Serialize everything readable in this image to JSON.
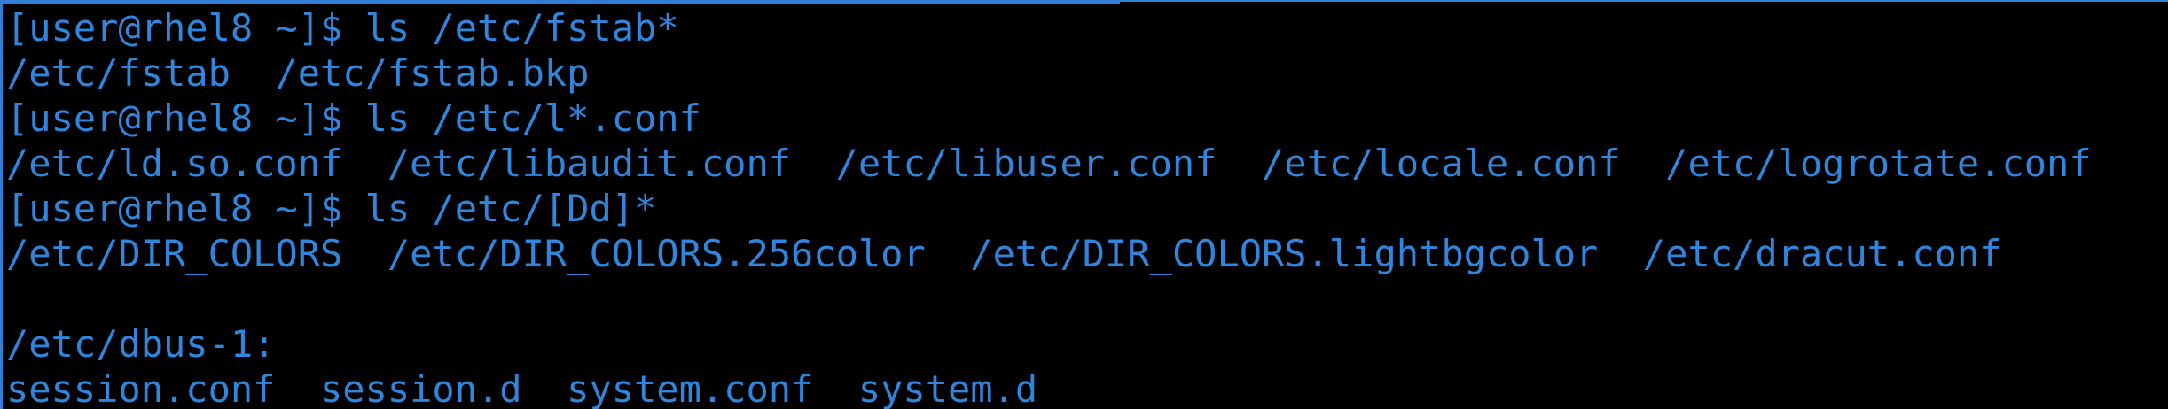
{
  "colors": {
    "background": "#000000",
    "text": "#2f86dc",
    "border": "#2f7fd6"
  },
  "terminal": {
    "lines": [
      "[user@rhel8 ~]$ ls /etc/fstab*",
      "/etc/fstab  /etc/fstab.bkp",
      "[user@rhel8 ~]$ ls /etc/l*.conf",
      "/etc/ld.so.conf  /etc/libaudit.conf  /etc/libuser.conf  /etc/locale.conf  /etc/logrotate.conf",
      "[user@rhel8 ~]$ ls /etc/[Dd]*",
      "/etc/DIR_COLORS  /etc/DIR_COLORS.256color  /etc/DIR_COLORS.lightbgcolor  /etc/dracut.conf",
      "",
      "/etc/dbus-1:",
      "session.conf  session.d  system.conf  system.d"
    ]
  }
}
